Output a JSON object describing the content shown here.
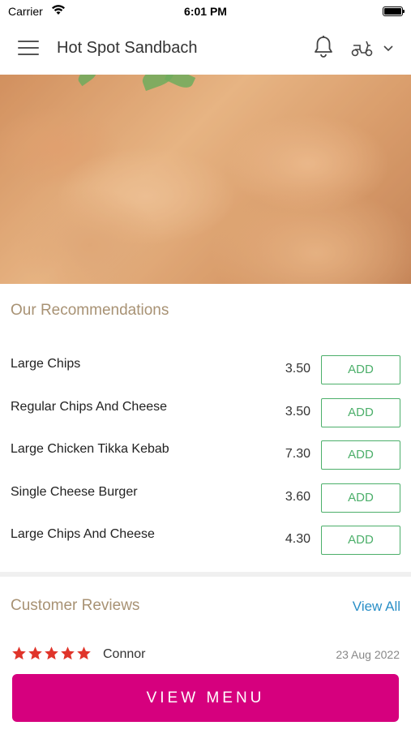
{
  "status": {
    "carrier": "Carrier",
    "time": "6:01 PM"
  },
  "header": {
    "title": "Hot Spot Sandbach"
  },
  "recommendations": {
    "title": "Our Recommendations",
    "add_label": "ADD",
    "items": [
      {
        "name": "Large Chips",
        "price": "3.50"
      },
      {
        "name": "Regular Chips And Cheese",
        "price": "3.50"
      },
      {
        "name": "Large Chicken Tikka Kebab",
        "price": "7.30"
      },
      {
        "name": "Single Cheese Burger",
        "price": "3.60"
      },
      {
        "name": "Large Chips And Cheese",
        "price": "4.30"
      }
    ]
  },
  "reviews": {
    "title": "Customer Reviews",
    "view_all": "View All",
    "first": {
      "rating": 5,
      "reviewer": "Connor",
      "date": "23 Aug 2022"
    }
  },
  "cta": {
    "label": "VIEW MENU"
  },
  "colors": {
    "accent": "#d6007e",
    "add_green": "#4caf6a",
    "link_blue": "#2a8fc7",
    "section_title": "#a89274",
    "star_red": "#e0342a"
  }
}
